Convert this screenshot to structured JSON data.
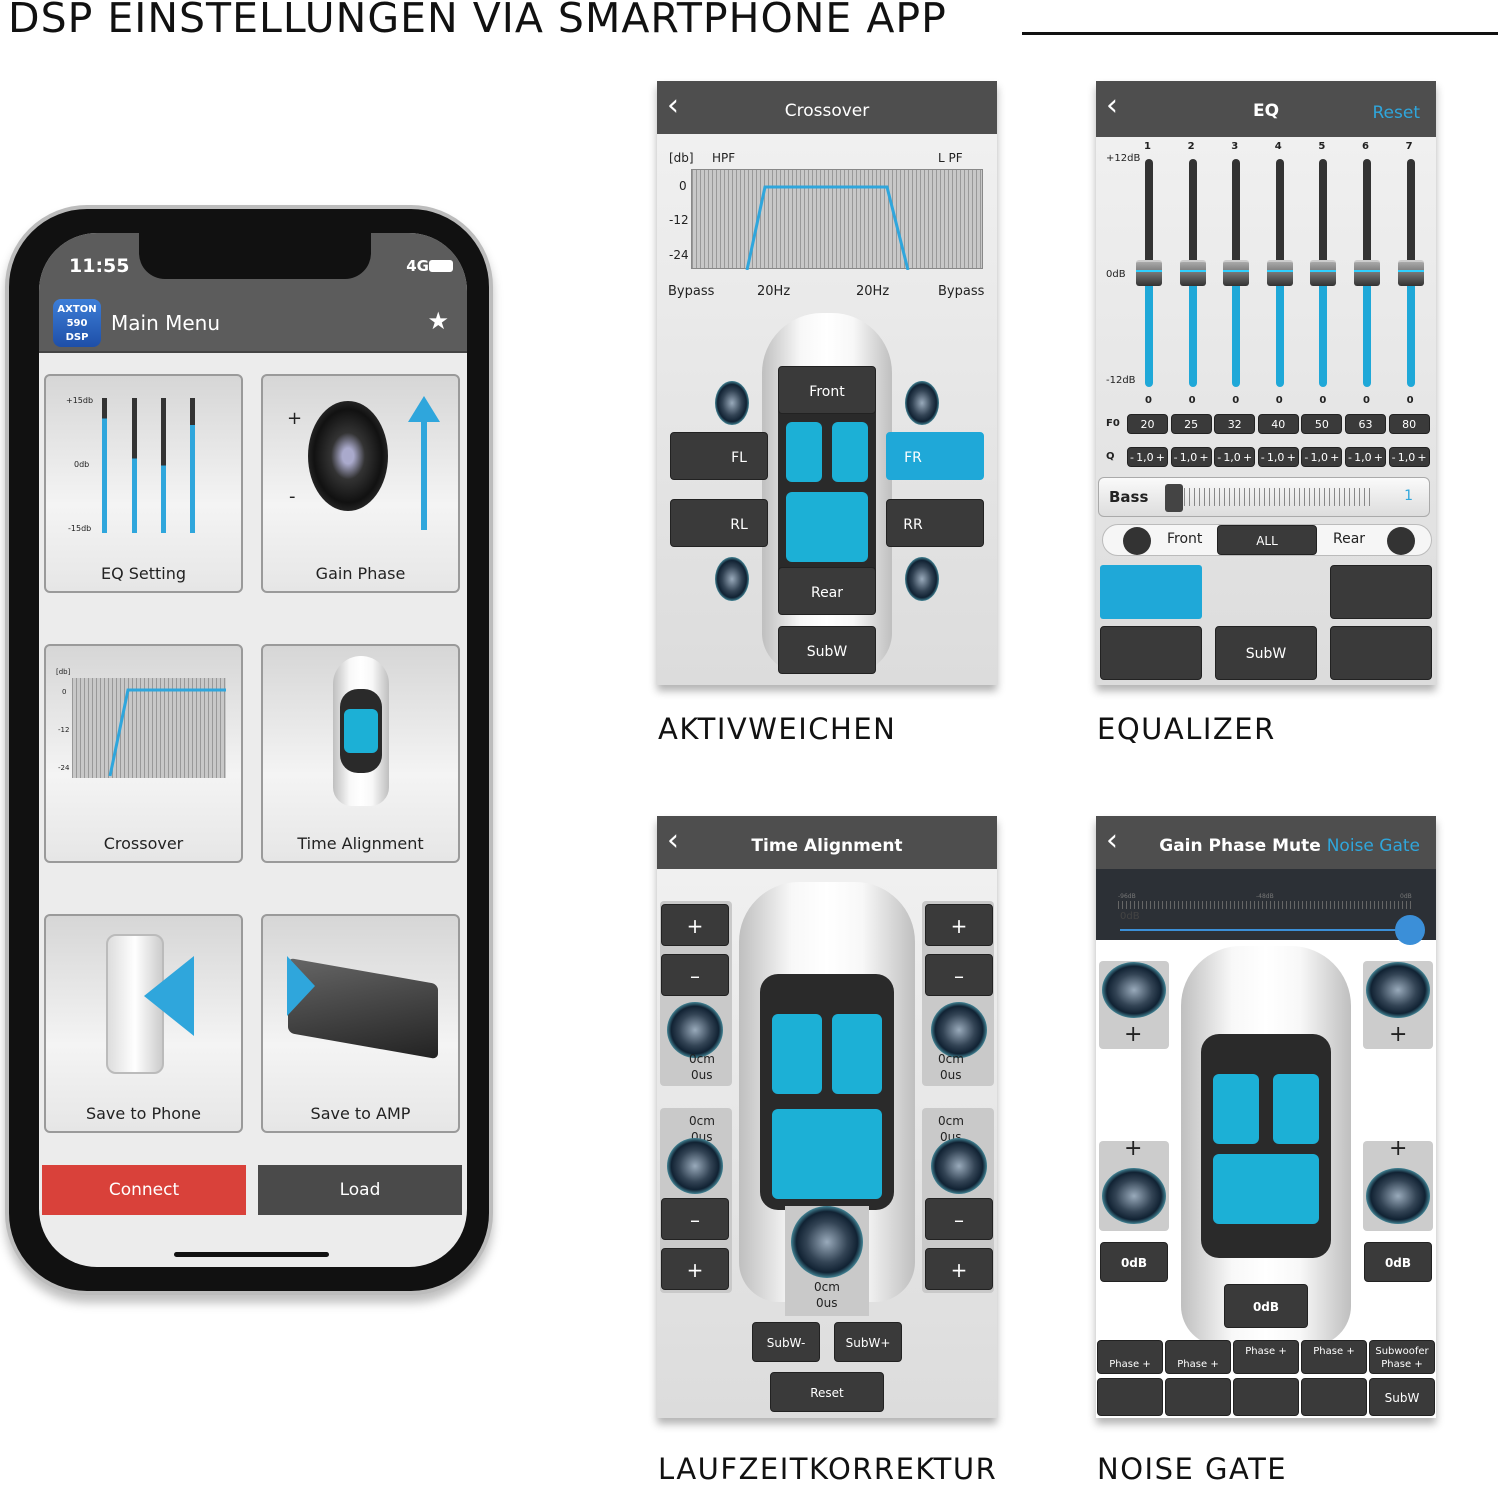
{
  "page": {
    "title": "DSP EINSTELLUNGEN VIA SMARTPHONE APP",
    "captions": [
      "AKTIVWEICHEN",
      "EQUALIZER",
      "LAUFZEITKORREKTUR",
      "NOISE GATE"
    ]
  },
  "phone": {
    "time": "11:55",
    "network": "4G",
    "logo": [
      "AXTON",
      "590",
      "DSP"
    ],
    "app_title": "Main Menu",
    "eq_tile_labels": [
      "+15db",
      "0db",
      "-15db"
    ],
    "gain_tile_marks": [
      "+",
      "-"
    ],
    "crossover_tile_labels": [
      "[db]",
      "0",
      "-12",
      "-24"
    ],
    "tiles": [
      "EQ Setting",
      "Gain Phase",
      "Crossover",
      "Time Alignment",
      "Save to Phone",
      "Save to AMP"
    ],
    "connect": "Connect",
    "load": "Load",
    "colors": {
      "connect": "#d9413a",
      "load": "#4a4a4a",
      "accent": "#2fa6dc"
    }
  },
  "crossover": {
    "title": "Crossover",
    "unit": "[db]",
    "hpf": "HPF",
    "lpf": "L PF",
    "y_ticks": [
      "0",
      "-12",
      "-24"
    ],
    "x_labels": [
      "Bypass",
      "20Hz",
      "20Hz",
      "Bypass"
    ],
    "buttons": {
      "front": "Front",
      "fl": "FL",
      "fr": "FR",
      "rl": "RL",
      "rr": "RR",
      "rear": "Rear",
      "subw": "SubW"
    },
    "selected": "FR"
  },
  "eq": {
    "title": "EQ",
    "reset": "Reset",
    "scale": [
      "+12dB",
      "0dB",
      "-12dB"
    ],
    "bands": [
      {
        "n": "1",
        "gain": "0",
        "f0": "20",
        "q": "1,0"
      },
      {
        "n": "2",
        "gain": "0",
        "f0": "25",
        "q": "1,0"
      },
      {
        "n": "3",
        "gain": "0",
        "f0": "32",
        "q": "1,0"
      },
      {
        "n": "4",
        "gain": "0",
        "f0": "40",
        "q": "1,0"
      },
      {
        "n": "5",
        "gain": "0",
        "f0": "50",
        "q": "1,0"
      },
      {
        "n": "6",
        "gain": "0",
        "f0": "63",
        "q": "1,0"
      },
      {
        "n": "7",
        "gain": "0",
        "f0": "80",
        "q": "1,0"
      }
    ],
    "f0_label": "F0",
    "q_label": "Q",
    "q_minus": "-",
    "q_plus": "+",
    "bass_label": "Bass",
    "bass_value": "1",
    "front": "Front",
    "all": "ALL",
    "rear": "Rear",
    "subw": "SubW"
  },
  "time_alignment": {
    "title": "Time Alignment",
    "plus": "+",
    "minus": "–",
    "channels": [
      {
        "cm": "0cm",
        "us": "0us"
      },
      {
        "cm": "0cm",
        "us": "0us"
      },
      {
        "cm": "0cm",
        "us": "0us"
      },
      {
        "cm": "0cm",
        "us": "0us"
      },
      {
        "cm": "0cm",
        "us": "0us"
      }
    ],
    "subw_minus": "SubW-",
    "subw_plus": "SubW+",
    "reset": "Reset"
  },
  "gain_phase": {
    "title": "Gain Phase Mute",
    "noise_gate": "Noise Gate",
    "slider_ticks": [
      "-96dB",
      "-48dB",
      "0dB"
    ],
    "slider_value": "0dB",
    "slider_percent": 100,
    "plus": "+",
    "gains": [
      "0dB",
      "0dB",
      "0dB"
    ],
    "phase": [
      "Phase +",
      "Phase +",
      "Phase +",
      "Phase +",
      "Subwoofer Phase +"
    ],
    "subw": "SubW"
  }
}
